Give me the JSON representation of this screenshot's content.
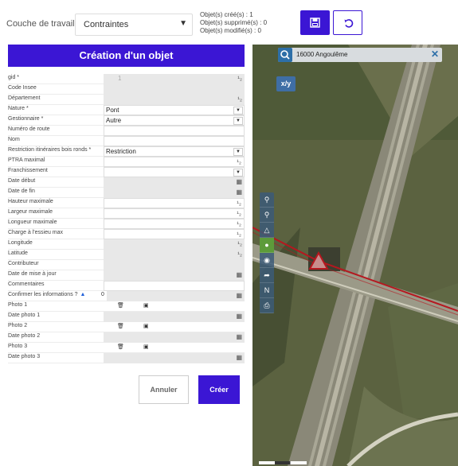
{
  "toolbar": {
    "layer_label": "Couche de travail",
    "layer_value": "Contraintes",
    "count_created": "Objet(s) créé(s) : 1",
    "count_deleted": "Objet(s) supprimé(s) : 0",
    "count_modified": "Objet(s) modifié(s) : 0",
    "save_icon": "save-icon",
    "undo_icon": "undo-icon"
  },
  "panel": {
    "title": "Création d'un objet"
  },
  "form": {
    "gid": {
      "label": "gid *",
      "value": "1"
    },
    "code_insee": {
      "label": "Code Insee"
    },
    "departement": {
      "label": "Département"
    },
    "nature": {
      "label": "Nature *",
      "value": "Pont"
    },
    "gestionnaire": {
      "label": "Gestionnaire *",
      "value": "Autre"
    },
    "numero_route": {
      "label": "Numéro de route"
    },
    "nom": {
      "label": "Nom"
    },
    "restriction": {
      "label": "Restriction itinéraires bois ronds *",
      "value": "Restriction"
    },
    "ptra": {
      "label": "PTRA maximal"
    },
    "franchissement": {
      "label": "Franchissement"
    },
    "date_debut": {
      "label": "Date début"
    },
    "date_fin": {
      "label": "Date de fin"
    },
    "hauteur": {
      "label": "Hauteur maximale"
    },
    "largeur": {
      "label": "Largeur maximale"
    },
    "longueur": {
      "label": "Longueur maximale"
    },
    "charge": {
      "label": "Charge à l'essieu max"
    },
    "longitude": {
      "label": "Longitude"
    },
    "latitude": {
      "label": "Latitude"
    },
    "contributeur": {
      "label": "Contributeur"
    },
    "date_maj": {
      "label": "Date de mise à jour"
    },
    "commentaires": {
      "label": "Commentaires"
    },
    "confirmer": {
      "label": "Confirmer les informations ?",
      "value": "0"
    },
    "photo1": {
      "label": "Photo 1"
    },
    "date_photo1": {
      "label": "Date photo 1"
    },
    "photo2": {
      "label": "Photo 2"
    },
    "date_photo2": {
      "label": "Date photo 2"
    },
    "photo3": {
      "label": "Photo 3"
    },
    "date_photo3": {
      "label": "Date photo 3"
    }
  },
  "actions": {
    "cancel": "Annuler",
    "create": "Créer"
  },
  "map": {
    "search_value": "16000 Angoulême",
    "xy_label": "x/y"
  }
}
